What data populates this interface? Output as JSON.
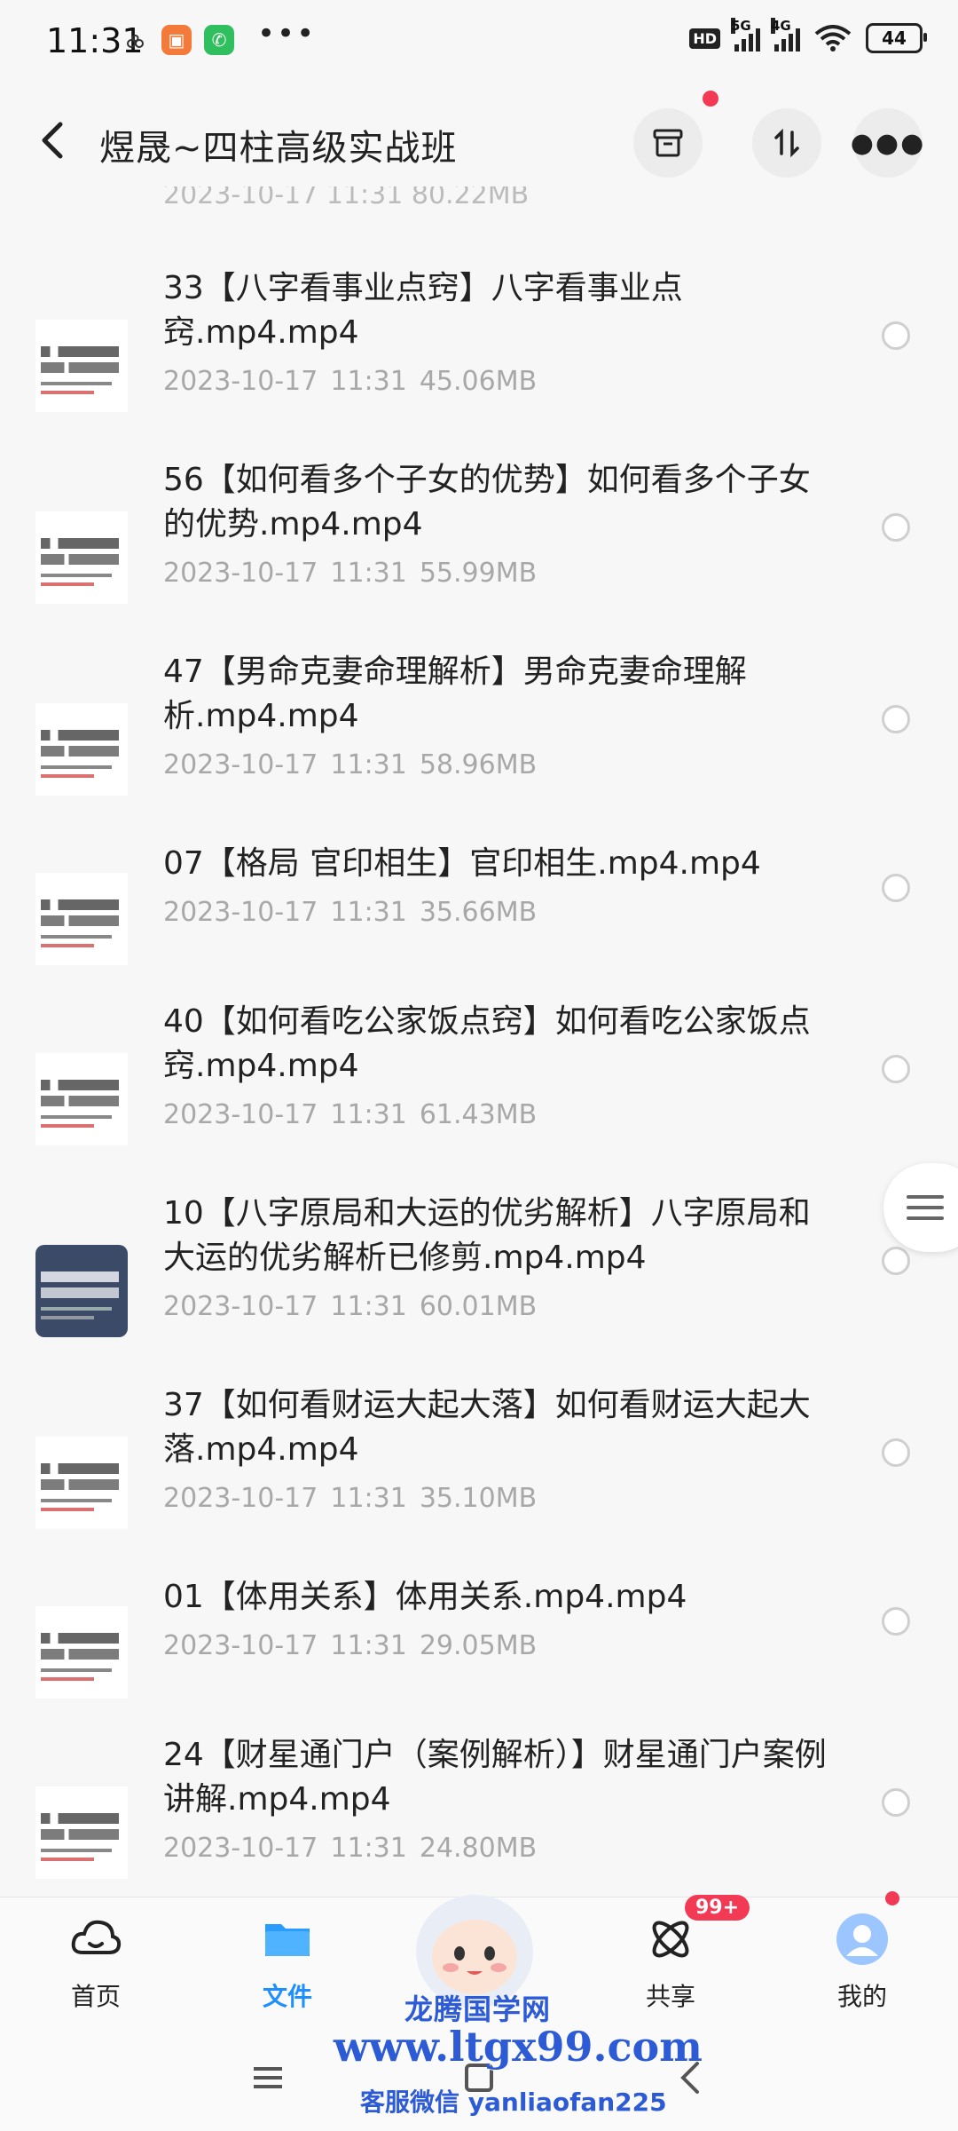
{
  "status_bar": {
    "time": "11:31",
    "left_icons": [
      "cloud-link-icon",
      "orange-app-icon",
      "phone-app-icon",
      "more-dots-icon"
    ],
    "hd": "HD",
    "net1": "5G",
    "net2": "4G",
    "battery": "44"
  },
  "header": {
    "title": "煜晟~四柱高级实战班",
    "back_icon": "back-arrow-icon",
    "actions": [
      "archive-icon",
      "sort-icon",
      "more-icon"
    ]
  },
  "partial_top_meta": "2023-10-17  11:31  80.22MB",
  "files": [
    {
      "name": "33【八字看事业点窍】八字看事业点窍.mp4.mp4",
      "date": "2023-10-17",
      "time": "11:31",
      "size": "45.06MB"
    },
    {
      "name": "56【如何看多个子女的优势】如何看多个子女的优势.mp4.mp4",
      "date": "2023-10-17",
      "time": "11:31",
      "size": "55.99MB"
    },
    {
      "name": "47【男命克妻命理解析】男命克妻命理解析.mp4.mp4",
      "date": "2023-10-17",
      "time": "11:31",
      "size": "58.96MB"
    },
    {
      "name": "07【格局  官印相生】官印相生.mp4.mp4",
      "date": "2023-10-17",
      "time": "11:31",
      "size": "35.66MB"
    },
    {
      "name": "40【如何看吃公家饭点窍】如何看吃公家饭点窍.mp4.mp4",
      "date": "2023-10-17",
      "time": "11:31",
      "size": "61.43MB"
    },
    {
      "name": "10【八字原局和大运的优劣解析】八字原局和大运的优劣解析已修剪.mp4.mp4",
      "date": "2023-10-17",
      "time": "11:31",
      "size": "60.01MB"
    },
    {
      "name": "37【如何看财运大起大落】如何看财运大起大落.mp4.mp4",
      "date": "2023-10-17",
      "time": "11:31",
      "size": "35.10MB"
    },
    {
      "name": "01【体用关系】体用关系.mp4.mp4",
      "date": "2023-10-17",
      "time": "11:31",
      "size": "29.05MB"
    },
    {
      "name": "24【财星通门户（案例解析）】财星通门户案例讲解.mp4.mp4",
      "date": "2023-10-17",
      "time": "11:31",
      "size": "24.80MB"
    }
  ],
  "tabs": [
    {
      "label": "首页",
      "icon": "cloud-icon",
      "active": false
    },
    {
      "label": "文件",
      "icon": "folder-icon",
      "active": true
    },
    {
      "label": "",
      "icon": "mascot-icon",
      "active": false
    },
    {
      "label": "共享",
      "icon": "share-atom-icon",
      "active": false
    },
    {
      "label": "我的",
      "icon": "profile-avatar-icon",
      "active": false
    }
  ],
  "share_badge": "99+",
  "watermark": {
    "line1": "龙腾国学网",
    "line2": "www.ltgx99.com",
    "line3": "客服微信 yanliaofan225"
  },
  "colors": {
    "accent": "#1e8fff",
    "badge": "#f23a55",
    "watermark": "#2d5bd6"
  }
}
